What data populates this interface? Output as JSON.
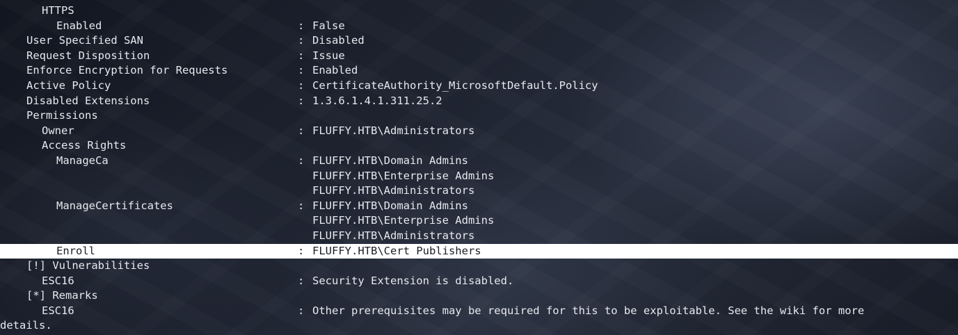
{
  "terminal": {
    "lines": [
      {
        "key": "HTTPS",
        "sep": "",
        "value": ""
      },
      {
        "key": "Enabled",
        "sep": ":",
        "value": "False"
      },
      {
        "key": "User Specified SAN",
        "sep": ":",
        "value": "Disabled"
      },
      {
        "key": "Request Disposition",
        "sep": ":",
        "value": "Issue"
      },
      {
        "key": "Enforce Encryption for Requests",
        "sep": ":",
        "value": "Enabled"
      },
      {
        "key": "Active Policy",
        "sep": ":",
        "value": "CertificateAuthority_MicrosoftDefault.Policy"
      },
      {
        "key": "Disabled Extensions",
        "sep": ":",
        "value": "1.3.6.1.4.1.311.25.2"
      },
      {
        "key": "Permissions",
        "sep": "",
        "value": ""
      },
      {
        "key": "Owner",
        "sep": ":",
        "value": "FLUFFY.HTB\\Administrators"
      },
      {
        "key": "Access Rights",
        "sep": "",
        "value": ""
      },
      {
        "key": "ManageCa",
        "sep": ":",
        "value": "FLUFFY.HTB\\Domain Admins"
      },
      {
        "key": "",
        "sep": "",
        "value": "FLUFFY.HTB\\Enterprise Admins"
      },
      {
        "key": "",
        "sep": "",
        "value": "FLUFFY.HTB\\Administrators"
      },
      {
        "key": "ManageCertificates",
        "sep": ":",
        "value": "FLUFFY.HTB\\Domain Admins"
      },
      {
        "key": "",
        "sep": "",
        "value": "FLUFFY.HTB\\Enterprise Admins"
      },
      {
        "key": "",
        "sep": "",
        "value": "FLUFFY.HTB\\Administrators"
      },
      {
        "key": "Enroll",
        "sep": ":",
        "value": "FLUFFY.HTB\\Cert Publishers"
      },
      {
        "key": "[!] Vulnerabilities",
        "sep": "",
        "value": ""
      },
      {
        "key": "ESC16",
        "sep": ":",
        "value": "Security Extension is disabled."
      },
      {
        "key": "[*] Remarks",
        "sep": "",
        "value": ""
      },
      {
        "key": "ESC16",
        "sep": ":",
        "value": "Other prerequisites may be required for this to be exploitable. See the wiki for more"
      },
      {
        "key": "details.",
        "sep": "",
        "value": ""
      }
    ]
  }
}
